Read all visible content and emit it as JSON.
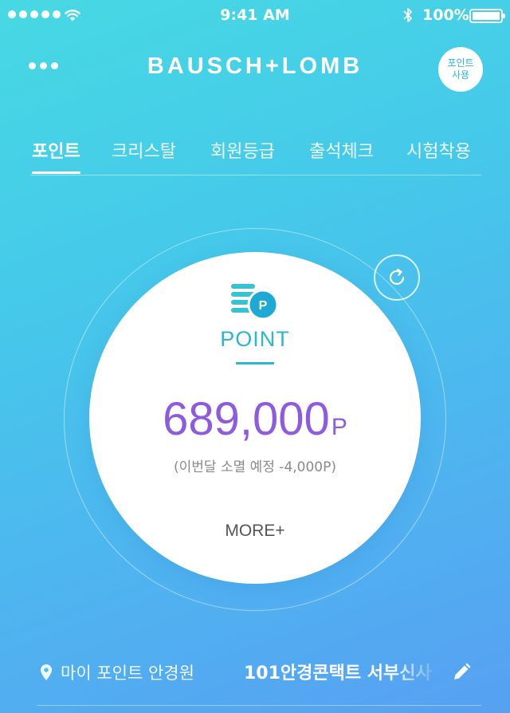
{
  "status_bar": {
    "time": "9:41 AM",
    "battery_percent": "100%",
    "icons": [
      "signal-dots",
      "wifi-icon",
      "bluetooth-icon",
      "battery-icon"
    ]
  },
  "header": {
    "brand": "BAUSCH+LOMB",
    "menu_icon": "more-dots-icon",
    "use_points_button": {
      "line1": "포인트",
      "line2": "사용"
    }
  },
  "tabs": [
    {
      "label": "포인트",
      "active": true
    },
    {
      "label": "크리스탈",
      "active": false
    },
    {
      "label": "회원등급",
      "active": false
    },
    {
      "label": "출석체크",
      "active": false
    },
    {
      "label": "시험착용",
      "active": false
    }
  ],
  "point_card": {
    "icon": "point-coin-icon",
    "icon_letter": "P",
    "label": "POINT",
    "value": "689,000",
    "unit": "P",
    "expire_note": "(이번달 소멸 예정 -4,000P)",
    "more": "MORE+"
  },
  "refresh_icon": "refresh-icon",
  "location": {
    "label": "마이 포인트 안경원",
    "store": "101안경콘택트 서부신사",
    "edit_icon": "pencil-icon"
  },
  "colors": {
    "gradient_start": "#47d9e3",
    "gradient_end": "#57a0f2",
    "accent_teal": "#2bb7cf",
    "point_purple": "#8c5be0"
  }
}
